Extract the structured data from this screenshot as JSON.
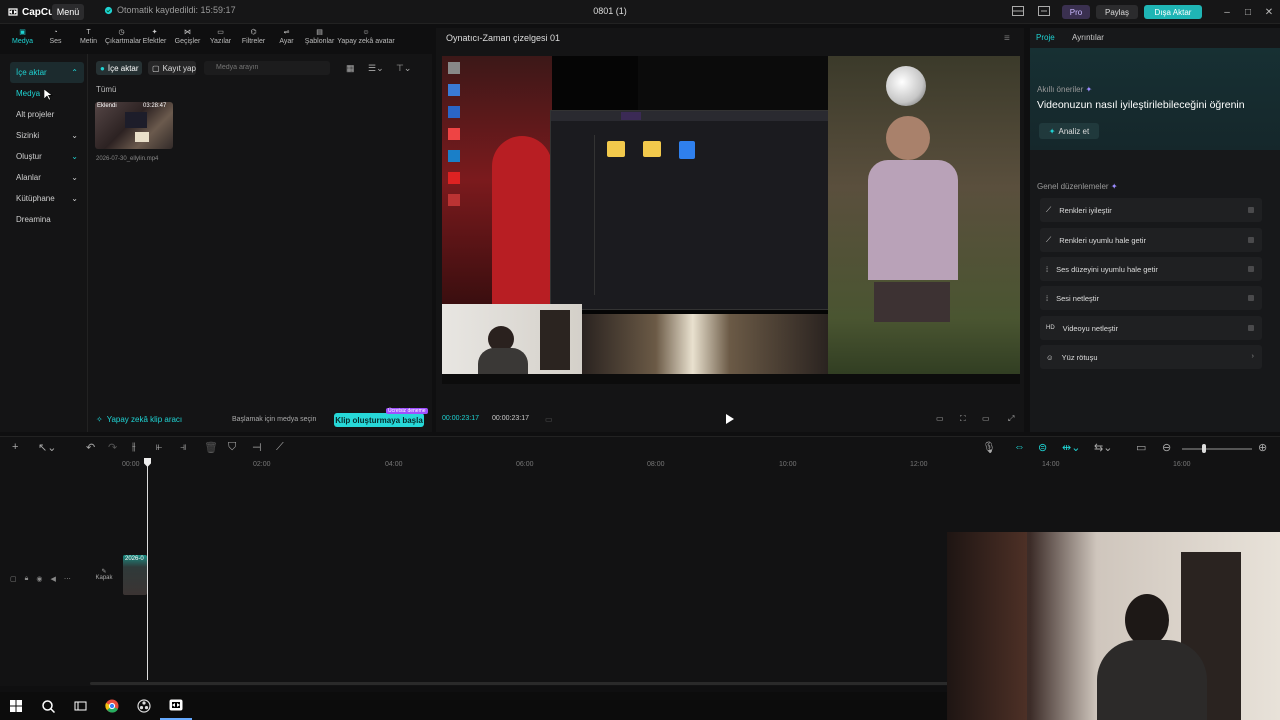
{
  "titlebar": {
    "app_name": "CapCut",
    "menu": "Menü",
    "autosave": "Otomatik kaydedildi: 15:59:17",
    "project_name": "0801 (1)",
    "pro": "Pro",
    "share": "Paylaş",
    "export": "Dışa Aktar"
  },
  "toolbar": {
    "media": "Medya",
    "audio": "Ses",
    "text": "Metin",
    "stickers": "Çıkartmalar",
    "effects": "Efektler",
    "transitions": "Geçişler",
    "captions": "Yazılar",
    "filters": "Filtreler",
    "adjust": "Ayar",
    "templates": "Şablonlar",
    "ai_avatar": "Yapay zekâ avatar"
  },
  "sidebar": {
    "import": "İçe aktar",
    "media": "Medya",
    "sub_projects": "Alt projeler",
    "yours": "Sizinki",
    "create": "Oluştur",
    "spaces": "Alanlar",
    "library": "Kütüphane",
    "dreamina": "Dreamina"
  },
  "media_panel": {
    "import_btn": "İçe aktar",
    "record_btn": "Kayıt yap",
    "search_placeholder": "Medya arayın",
    "all_label": "Tümü",
    "thumb_added": "Eklendi",
    "thumb_duration": "03:28:47",
    "thumb_name": "2026-07-30_ellylin.mp4",
    "ai_tool": "Yapay zekâ klip aracı",
    "ai_hint": "Başlamak için medya seçin",
    "ai_start": "Klip oluşturmaya başla",
    "ai_badge": "Ücretsiz deneme"
  },
  "player": {
    "title": "Oynatıcı-Zaman çizelgesi 01",
    "time_current": "00:00:23:17",
    "time_total": "00:00:23:17"
  },
  "right_panel": {
    "tab_project": "Proje",
    "tab_details": "Ayrıntılar",
    "smart_title": "Akıllı öneriler",
    "smart_head": "Videonuzun nasıl iyileştirilebileceğini öğrenin",
    "analyze": "Analiz et",
    "general_title": "Genel düzenlemeler",
    "edits": [
      {
        "label": "Renkleri iyileştir",
        "icon": "color-enhance-icon"
      },
      {
        "label": "Renkleri uyumlu hale getir",
        "icon": "color-match-icon"
      },
      {
        "label": "Ses düzeyini uyumlu hale getir",
        "icon": "volume-normalize-icon"
      },
      {
        "label": "Sesi netleştir",
        "icon": "voice-clarify-icon"
      },
      {
        "label": "Videoyu netleştir",
        "icon": "hd-icon"
      },
      {
        "label": "Yüz rötuşu",
        "icon": "face-retouch-icon"
      }
    ]
  },
  "timeline": {
    "ticks": [
      "00:00",
      "02:00",
      "04:00",
      "06:00",
      "08:00",
      "10:00",
      "12:00",
      "14:00",
      "16:00"
    ],
    "clip_label": "2026-0",
    "cover": "Kapak"
  },
  "colors": {
    "accent": "#1fd3d3",
    "export": "#1fb5b5"
  }
}
